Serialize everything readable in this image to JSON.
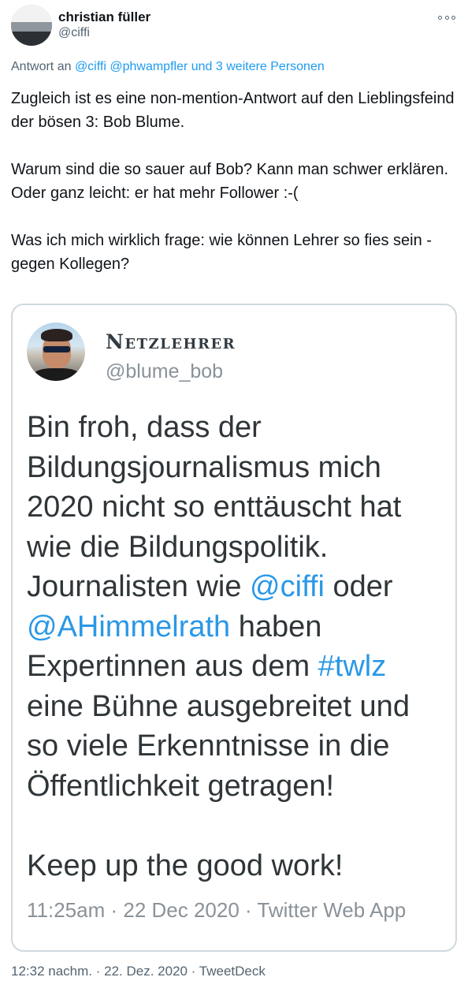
{
  "author": {
    "name": "christian füller",
    "handle": "@ciffi"
  },
  "icons": {
    "more": "more-options-icon"
  },
  "reply_to": {
    "prefix": "Antwort an",
    "mentions": [
      "@ciffi",
      "@phwampfler"
    ],
    "suffix": "und 3 weitere Personen"
  },
  "tweet": {
    "text": "Zugleich ist es eine non-mention-Antwort auf den Lieblingsfeind der bösen 3: Bob Blume.\n\nWarum sind die so sauer auf Bob? Kann man schwer erklären. Oder ganz leicht: er hat mehr Follower :-(\n\nWas ich mich wirklich frage: wie können Lehrer so fies sein - gegen Kollegen?",
    "meta": "12:32 nachm. · 22. Dez. 2020 · TweetDeck"
  },
  "quoted": {
    "name": "Netzlehrer",
    "handle": "@blume_bob",
    "text_parts": {
      "line1": "Bin froh, dass der",
      "line2": "Bildungsjournalismus mich",
      "line3": "2020 nicht so enttäuscht hat",
      "line4": "wie die Bildungspolitik.",
      "line5_pre": "Journalisten wie ",
      "mention1": "@ciffi",
      "line5_post": " oder",
      "mention2": "@AHimmelrath",
      "line6_post": " haben",
      "line7_pre": "Expertinnen aus dem ",
      "hashtag": "#twlz",
      "line8": "eine Bühne ausgebreitet und",
      "line9": "so viele Erkenntnisse in die",
      "line10": "Öffentlichkeit getragen!",
      "closing": "Keep up the good work!"
    },
    "meta": "11:25am · 22 Dec 2020 · Twitter Web App"
  },
  "colors": {
    "link": "#1d9bf0",
    "secondary_text": "#536471",
    "border": "#cfd9de"
  }
}
